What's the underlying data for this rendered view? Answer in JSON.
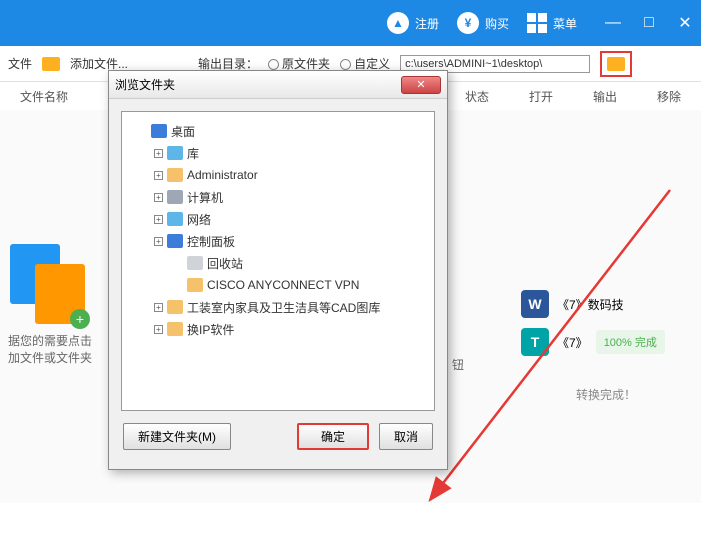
{
  "titlebar": {
    "register": "注册",
    "buy": "购买",
    "menu": "菜单"
  },
  "toolbar": {
    "file": "文件",
    "addfile": "添加文件...",
    "outputdir": "输出目录：",
    "radio1": "原文件夹",
    "radio2": "自定义",
    "path": "c:\\users\\ADMINI~1\\desktop\\"
  },
  "columns": {
    "filename": "文件名称",
    "status": "状态",
    "open": "打开",
    "output": "输出",
    "remove": "移除"
  },
  "empty": {
    "line1": "据您的需要点击",
    "line2": "加文件或文件夹",
    "button": "钮"
  },
  "dialog": {
    "title": "浏览文件夹",
    "tree": [
      {
        "label": "桌面",
        "icon": "#3b7dd8",
        "expand": "none",
        "lvl": 0
      },
      {
        "label": "库",
        "icon": "#5eb5e8",
        "expand": "plus",
        "lvl": 1
      },
      {
        "label": "Administrator",
        "icon": "#f5c26b",
        "expand": "plus",
        "lvl": 1
      },
      {
        "label": "计算机",
        "icon": "#9ea7b3",
        "expand": "plus",
        "lvl": 1
      },
      {
        "label": "网络",
        "icon": "#5eb5e8",
        "expand": "plus",
        "lvl": 1
      },
      {
        "label": "控制面板",
        "icon": "#3b7dd8",
        "expand": "plus",
        "lvl": 1
      },
      {
        "label": "回收站",
        "icon": "#d0d4d9",
        "expand": "none",
        "lvl": 2
      },
      {
        "label": "CISCO ANYCONNECT VPN",
        "icon": "#f5c26b",
        "expand": "none",
        "lvl": 2
      },
      {
        "label": "工装室内家具及卫生洁具等CAD图库",
        "icon": "#f5c26b",
        "expand": "plus",
        "lvl": 1
      },
      {
        "label": "换IP软件",
        "icon": "#f5c26b",
        "expand": "plus",
        "lvl": 1
      }
    ],
    "newfolder": "新建文件夹(M)",
    "ok": "确定",
    "cancel": "取消"
  },
  "right": {
    "doc1": "《7》数码技",
    "doc2": "《7》",
    "progress": "100% 完成",
    "done": "转换完成！"
  },
  "colors": {
    "accent": "#1e88e5",
    "annot": "#e53935"
  }
}
